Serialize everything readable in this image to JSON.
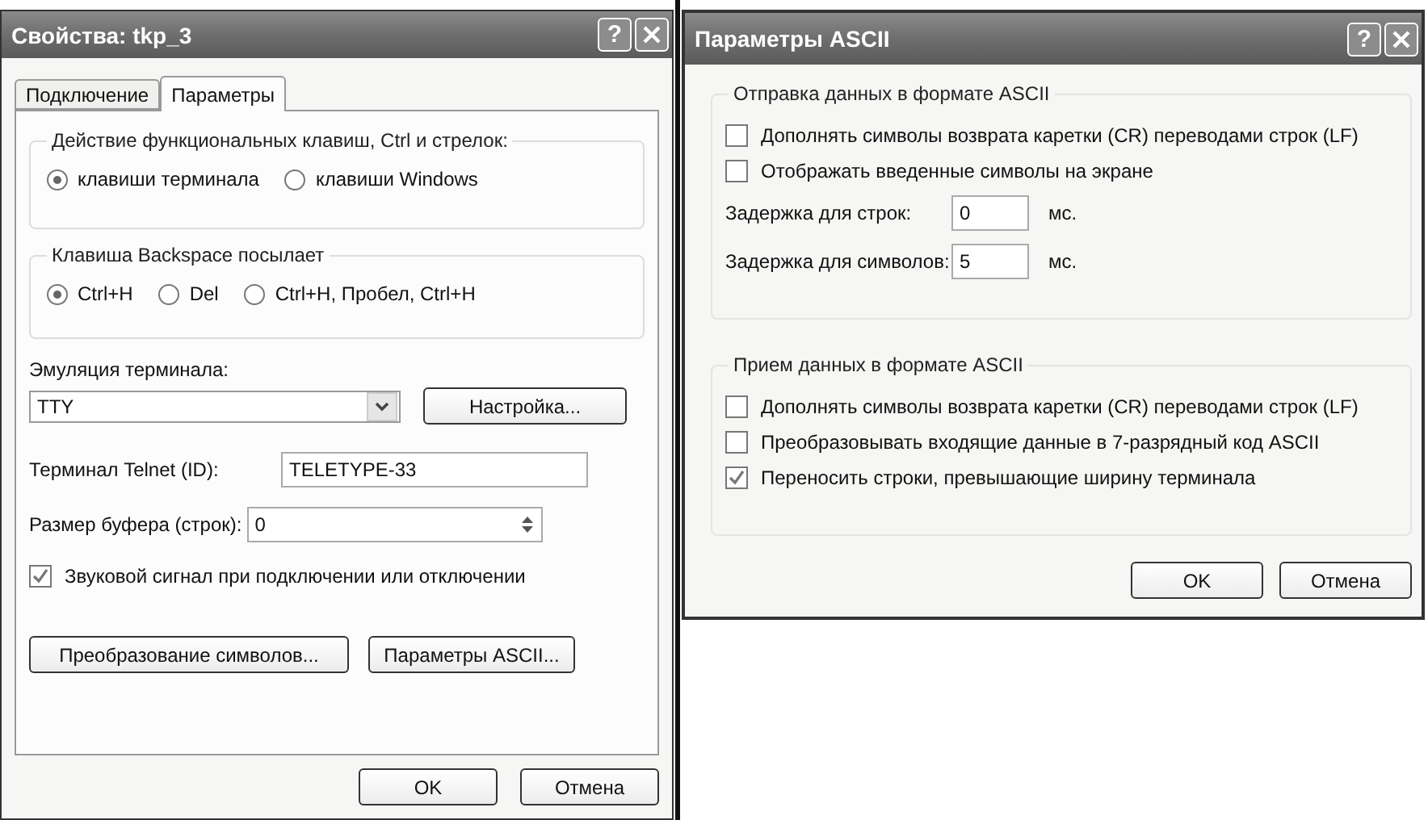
{
  "properties_dialog": {
    "title": "Свойства: tkp_3",
    "help_button": "?",
    "tabs": [
      {
        "label": "Подключение",
        "selected": false
      },
      {
        "label": "Параметры",
        "selected": true
      }
    ],
    "function_keys_group": {
      "legend": "Действие функциональных клавиш, Ctrl и стрелок:",
      "options": [
        {
          "label": "клавиши терминала",
          "selected": true
        },
        {
          "label": "клавиши Windows",
          "selected": false
        }
      ]
    },
    "backspace_group": {
      "legend": "Клавиша  Backspace посылает",
      "options": [
        {
          "label": "Ctrl+H",
          "selected": true
        },
        {
          "label": "Del",
          "selected": false
        },
        {
          "label": "Ctrl+H, Пробел, Ctrl+H",
          "selected": false
        }
      ]
    },
    "emulation": {
      "label": "Эмуляция терминала:",
      "value": "TTY",
      "setup_button": "Настройка..."
    },
    "telnet_id": {
      "label": "Терминал Telnet (ID):",
      "value": "TELETYPE-33"
    },
    "buffer_size": {
      "label": "Размер буфера (строк):",
      "value": "0"
    },
    "sound_checkbox": {
      "label": "Звуковой сигнал при подключении или отключении",
      "checked": true
    },
    "buttons": [
      "Преобразование символов...",
      "Параметры ASCII..."
    ],
    "footer_buttons": [
      "OK",
      "Отмена"
    ]
  },
  "ascii_dialog": {
    "title": "Параметры ASCII",
    "help_button": "?",
    "send_group": {
      "legend": "Отправка данных в формате ASCII",
      "checkboxes": [
        {
          "label": "Дополнять символы возврата каретки (CR) переводами строк (LF)",
          "checked": false
        },
        {
          "label": "Отображать введенные символы на экране",
          "checked": false
        }
      ],
      "delays": [
        {
          "label": "Задержка для строк:",
          "value": "0",
          "unit": "мс."
        },
        {
          "label": "Задержка для символов:",
          "value": "5",
          "unit": "мс."
        }
      ]
    },
    "receive_group": {
      "legend": "Прием данных в формате ASCII",
      "checkboxes": [
        {
          "label": "Дополнять символы возврата каретки (CR) переводами строк (LF)",
          "checked": false
        },
        {
          "label": "Преобразовывать входящие данные в 7-разрядный код ASCII",
          "checked": false
        },
        {
          "label": "Переносить строки, превышающие ширину терминала",
          "checked": true
        }
      ]
    },
    "footer_buttons": [
      "OK",
      "Отмена"
    ]
  }
}
